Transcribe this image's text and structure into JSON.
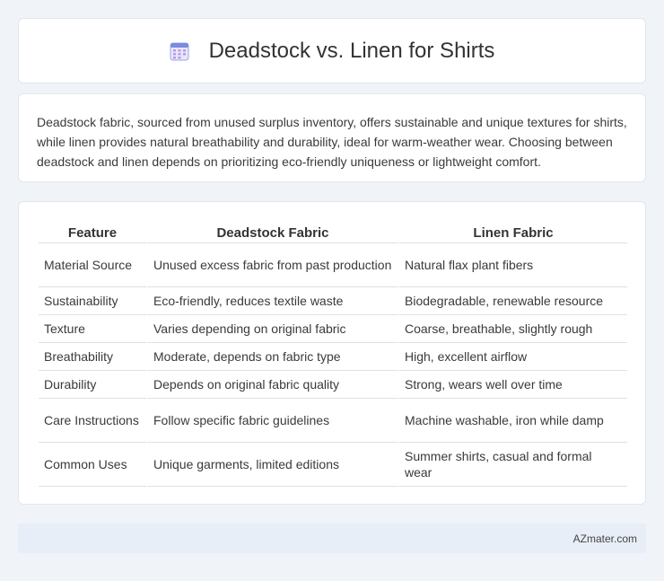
{
  "title": "Deadstock vs. Linen for Shirts",
  "description": "Deadstock fabric, sourced from unused surplus inventory, offers sustainable and unique textures for shirts, while linen provides natural breathability and durability, ideal for warm-weather wear. Choosing between deadstock and linen depends on prioritizing eco-friendly uniqueness or lightweight comfort.",
  "table": {
    "headers": [
      "Feature",
      "Deadstock Fabric",
      "Linen Fabric"
    ],
    "rows": [
      [
        "Material Source",
        "Unused excess fabric from past production",
        "Natural flax plant fibers"
      ],
      [
        "Sustainability",
        "Eco-friendly, reduces textile waste",
        "Biodegradable, renewable resource"
      ],
      [
        "Texture",
        "Varies depending on original fabric",
        "Coarse, breathable, slightly rough"
      ],
      [
        "Breathability",
        "Moderate, depends on fabric type",
        "High, excellent airflow"
      ],
      [
        "Durability",
        "Depends on original fabric quality",
        "Strong, wears well over time"
      ],
      [
        "Care Instructions",
        "Follow specific fabric guidelines",
        "Machine washable, iron while damp"
      ],
      [
        "Common Uses",
        "Unique garments, limited editions",
        "Summer shirts, casual and formal wear"
      ]
    ]
  },
  "footer": "AZmater.com",
  "icon": "calendar-icon",
  "colors": {
    "background": "#f0f3f8",
    "footer_bg": "#e8eef7",
    "icon_accent": "#7b8cde"
  }
}
